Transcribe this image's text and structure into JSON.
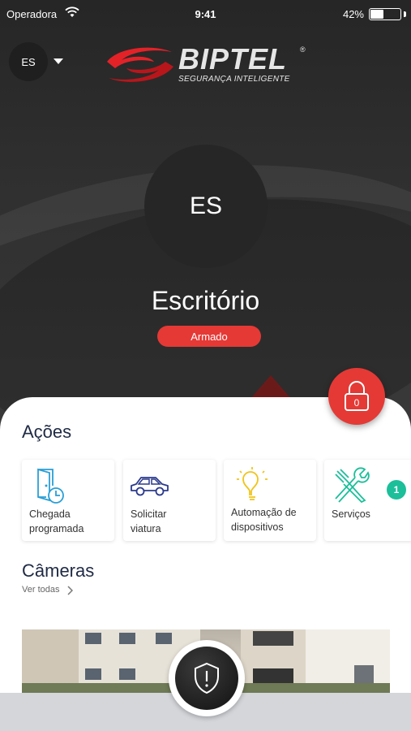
{
  "status_bar": {
    "carrier": "Operadora",
    "time": "9:41",
    "battery_percent": "42%",
    "battery_level": 0.42
  },
  "header": {
    "account_initials": "ES",
    "logo_name": "BIPTEL",
    "logo_tagline": "SEGURANÇA INTELIGENTE",
    "logo_mark": "®"
  },
  "site": {
    "initials": "ES",
    "name": "Escritório",
    "status": "Armado"
  },
  "lock_button": {
    "count": "0"
  },
  "actions": {
    "title": "Ações",
    "items": [
      {
        "label_line1": "Chegada",
        "label_line2": "programada",
        "icon": "door-clock-icon"
      },
      {
        "label_line1": "Solicitar",
        "label_line2": "viatura",
        "icon": "car-icon"
      },
      {
        "label_line1": "Automação de",
        "label_line2": "dispositivos",
        "icon": "lightbulb-icon"
      },
      {
        "label_line1": "Serviços",
        "label_line2": "",
        "icon": "tools-icon"
      }
    ],
    "badge": "1"
  },
  "cameras": {
    "title": "Câmeras",
    "see_all": "Ver todas"
  },
  "colors": {
    "accent_red": "#e53935",
    "badge_teal": "#1cbf9a",
    "icon_blue": "#2a9fd6",
    "icon_navy": "#2b3a8c",
    "icon_yellow": "#f0c419",
    "icon_teal": "#1cbf9a"
  }
}
